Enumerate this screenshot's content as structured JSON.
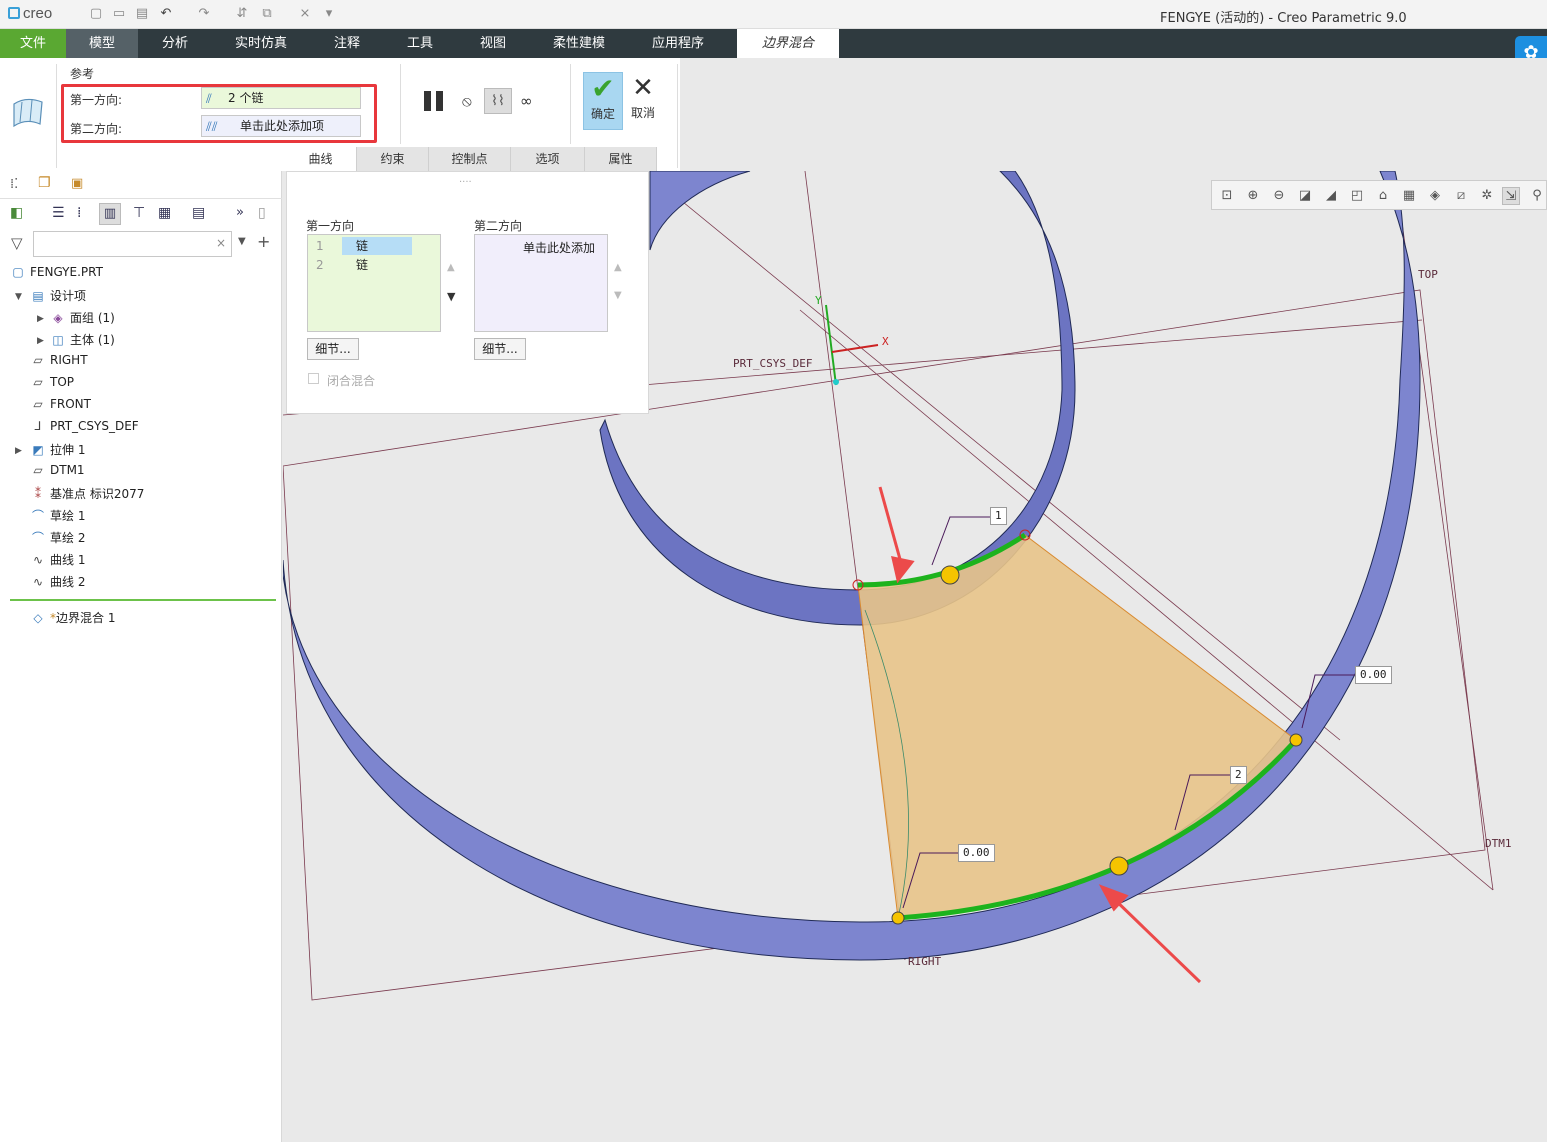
{
  "app": {
    "logo": "creo",
    "window_title": "FENGYE (活动的) - Creo Parametric 9.0"
  },
  "ribbon_tabs": [
    "文件",
    "模型",
    "分析",
    "实时仿真",
    "注释",
    "工具",
    "视图",
    "柔性建模",
    "应用程序",
    "边界混合"
  ],
  "references": {
    "title": "参考",
    "dir1_label": "第一方向:",
    "dir1_value": "2 个链",
    "dir2_label": "第二方向:",
    "dir2_value": "单击此处添加项"
  },
  "actions": {
    "ok": "确定",
    "cancel": "取消"
  },
  "sub_tabs": [
    "曲线",
    "约束",
    "控制点",
    "选项",
    "属性"
  ],
  "flyout": {
    "dir1_title": "第一方向",
    "dir2_title": "第二方向",
    "dir1_items": [
      {
        "num": "1",
        "label": "链"
      },
      {
        "num": "2",
        "label": "链"
      }
    ],
    "dir2_placeholder": "单击此处添加",
    "details": "细节...",
    "closed_blend": "闭合混合"
  },
  "tree": {
    "root": "FENGYE.PRT",
    "items": [
      {
        "label": "设计项",
        "icon": "design-items-icon"
      },
      {
        "label": "面组 (1)",
        "icon": "quilt-icon"
      },
      {
        "label": "主体 (1)",
        "icon": "body-icon"
      },
      {
        "label": "RIGHT",
        "icon": "plane-icon"
      },
      {
        "label": "TOP",
        "icon": "plane-icon"
      },
      {
        "label": "FRONT",
        "icon": "plane-icon"
      },
      {
        "label": "PRT_CSYS_DEF",
        "icon": "csys-icon"
      },
      {
        "label": "拉伸 1",
        "icon": "extrude-icon"
      },
      {
        "label": "DTM1",
        "icon": "plane-icon"
      },
      {
        "label": "基准点 标识2077",
        "icon": "datum-point-icon"
      },
      {
        "label": "草绘 1",
        "icon": "sketch-icon"
      },
      {
        "label": "草绘 2",
        "icon": "sketch-icon"
      },
      {
        "label": "曲线 1",
        "icon": "curve-icon"
      },
      {
        "label": "曲线 2",
        "icon": "curve-icon"
      },
      {
        "label": "边界混合 1",
        "icon": "boundary-blend-icon"
      }
    ]
  },
  "viewport": {
    "labels": {
      "top": "TOP",
      "right": "RIGHT",
      "dtm1": "DTM1",
      "csys": "PRT_CSYS_DEF",
      "x": "X",
      "y": "Y"
    },
    "dims": {
      "d1": "0.00",
      "d2": "0.00",
      "c1": "1",
      "c2": "2"
    }
  },
  "colors": {
    "accent_green": "#5aa832",
    "ribbon_dark": "#2f3a3f",
    "highlight_red": "#e8373c",
    "surface_fill": "#e8c48a",
    "ring": "#8a94d8"
  }
}
